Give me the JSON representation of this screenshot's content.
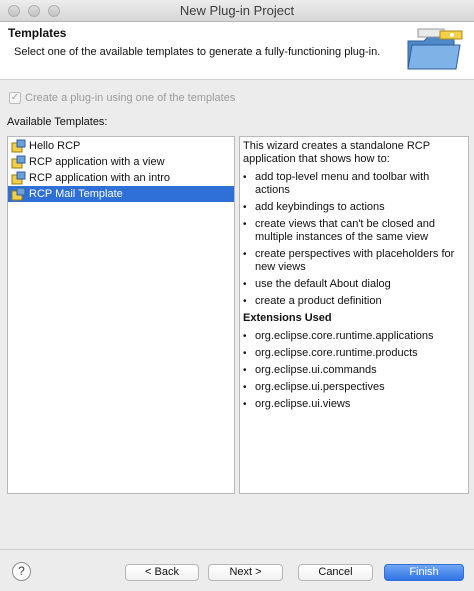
{
  "window": {
    "title": "New Plug-in Project"
  },
  "header": {
    "title": "Templates",
    "description": "Select one of the available templates to generate a fully-functioning plug-in.",
    "icon": "wizard-folder-icon"
  },
  "checkbox": {
    "label": "Create a plug-in using one of the templates",
    "checked": true,
    "enabled": false
  },
  "available_label": "Available Templates:",
  "templates": [
    {
      "label": "Hello RCP",
      "selected": false,
      "icon": "plugin-template-icon"
    },
    {
      "label": "RCP application with a view",
      "selected": false,
      "icon": "plugin-template-icon"
    },
    {
      "label": "RCP application with an intro",
      "selected": false,
      "icon": "plugin-template-icon"
    },
    {
      "label": "RCP Mail Template",
      "selected": true,
      "icon": "plugin-template-icon"
    }
  ],
  "description": {
    "intro": "This wizard creates a standalone RCP application that shows how to:",
    "bullets": [
      "add top-level menu and toolbar with actions",
      "add keybindings to actions",
      "create views that can't be closed and multiple instances of the same view",
      "create perspectives with placeholders for new views",
      "use the default About dialog",
      "create a product definition"
    ],
    "extensions_heading": "Extensions Used",
    "extensions": [
      "org.eclipse.core.runtime.applications",
      "org.eclipse.core.runtime.products",
      "org.eclipse.ui.commands",
      "org.eclipse.ui.perspectives",
      "org.eclipse.ui.views"
    ]
  },
  "buttons": {
    "help": "?",
    "back": "< Back",
    "next": "Next >",
    "cancel": "Cancel",
    "finish": "Finish"
  },
  "colors": {
    "selection": "#2f6fd8",
    "finish_button": "#2f74e6"
  }
}
